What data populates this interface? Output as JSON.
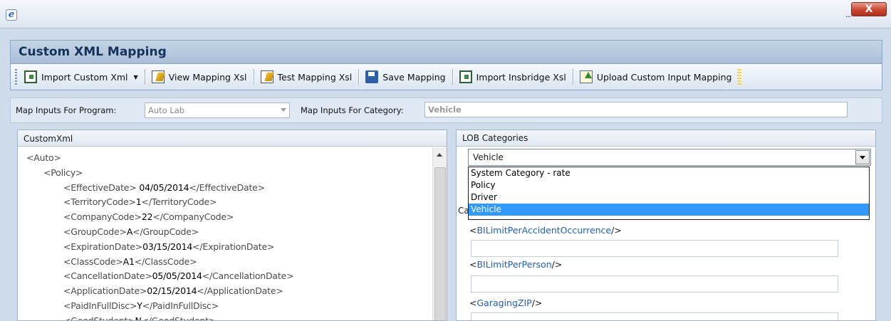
{
  "window": {
    "close_label": "X",
    "min_label": "..."
  },
  "header": {
    "title": "Custom XML Mapping"
  },
  "toolbar": {
    "import_custom": "Import Custom Xml",
    "view_mapping": "View Mapping Xsl",
    "test_mapping": "Test Mapping Xsl",
    "save_mapping": "Save Mapping",
    "import_insbridge": "Import Insbridge Xsl",
    "upload_custom": "Upload Custom Input Mapping"
  },
  "filter": {
    "program_label": "Map Inputs For Program:",
    "program_value": "Auto Lab",
    "category_label": "Map Inputs For Category:",
    "category_value": "Vehicle"
  },
  "custom_xml": {
    "title": "CustomXml",
    "lines": [
      {
        "open": "<Auto>",
        "value": "",
        "close": ""
      },
      {
        "open": "<Policy>",
        "value": "",
        "close": ""
      },
      {
        "open": "<EffectiveDate>",
        "value": " 04/05/2014",
        "close": "</EffectiveDate>"
      },
      {
        "open": "<TerritoryCode>",
        "value": "1",
        "close": "</TerritoryCode>"
      },
      {
        "open": "<CompanyCode>",
        "value": "22",
        "close": "</CompanyCode>"
      },
      {
        "open": "<GroupCode>",
        "value": "A",
        "close": "</GroupCode>"
      },
      {
        "open": "<ExpirationDate>",
        "value": "03/15/2014",
        "close": "</ExpirationDate>"
      },
      {
        "open": "<ClassCode>",
        "value": "A1",
        "close": "</ClassCode>"
      },
      {
        "open": "<CancellationDate>",
        "value": "05/05/2014",
        "close": "</CancellationDate>"
      },
      {
        "open": "<ApplicationDate>",
        "value": "02/15/2014",
        "close": "</ApplicationDate>"
      },
      {
        "open": "<PaidInFullDisc>",
        "value": "Y",
        "close": "</PaidInFullDisc>"
      },
      {
        "open": "<GoodStudent>",
        "value": "N",
        "close": "</GoodStudent>"
      }
    ]
  },
  "lob": {
    "title": "LOB Categories",
    "selected": "Vehicle",
    "options": [
      "System Category - rate",
      "Policy",
      "Driver",
      "Vehicle"
    ],
    "category_label_partial": "Ca",
    "fields": [
      {
        "open": "<",
        "name": "BILimitPerAccidentOccurrence",
        "close": "/>"
      },
      {
        "open": "<",
        "name": "BILimitPerPerson",
        "close": "/>"
      },
      {
        "open": "<",
        "name": "GaragingZIP",
        "close": "/>"
      }
    ]
  }
}
